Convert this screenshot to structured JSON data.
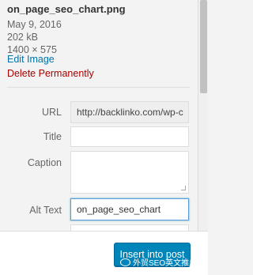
{
  "attachment": {
    "filename": "on_page_seo_chart.png",
    "date": "May 9, 2016",
    "size": "202 kB",
    "dimensions": "1400 × 575",
    "edit_link": "Edit Image",
    "delete_link": "Delete Permanently"
  },
  "fields": {
    "url_label": "URL",
    "url_value": "http://backlinko.com/wp-c",
    "title_label": "Title",
    "title_value": "",
    "caption_label": "Caption",
    "caption_value": "",
    "alt_label": "Alt Text",
    "alt_value": "on_page_seo_chart"
  },
  "footer": {
    "insert_button": "Insert into post",
    "watermark_text": "外贸SEO英文推广"
  },
  "colors": {
    "link": "#0073aa",
    "delete": "#aa0000",
    "button": "#0085ba"
  }
}
